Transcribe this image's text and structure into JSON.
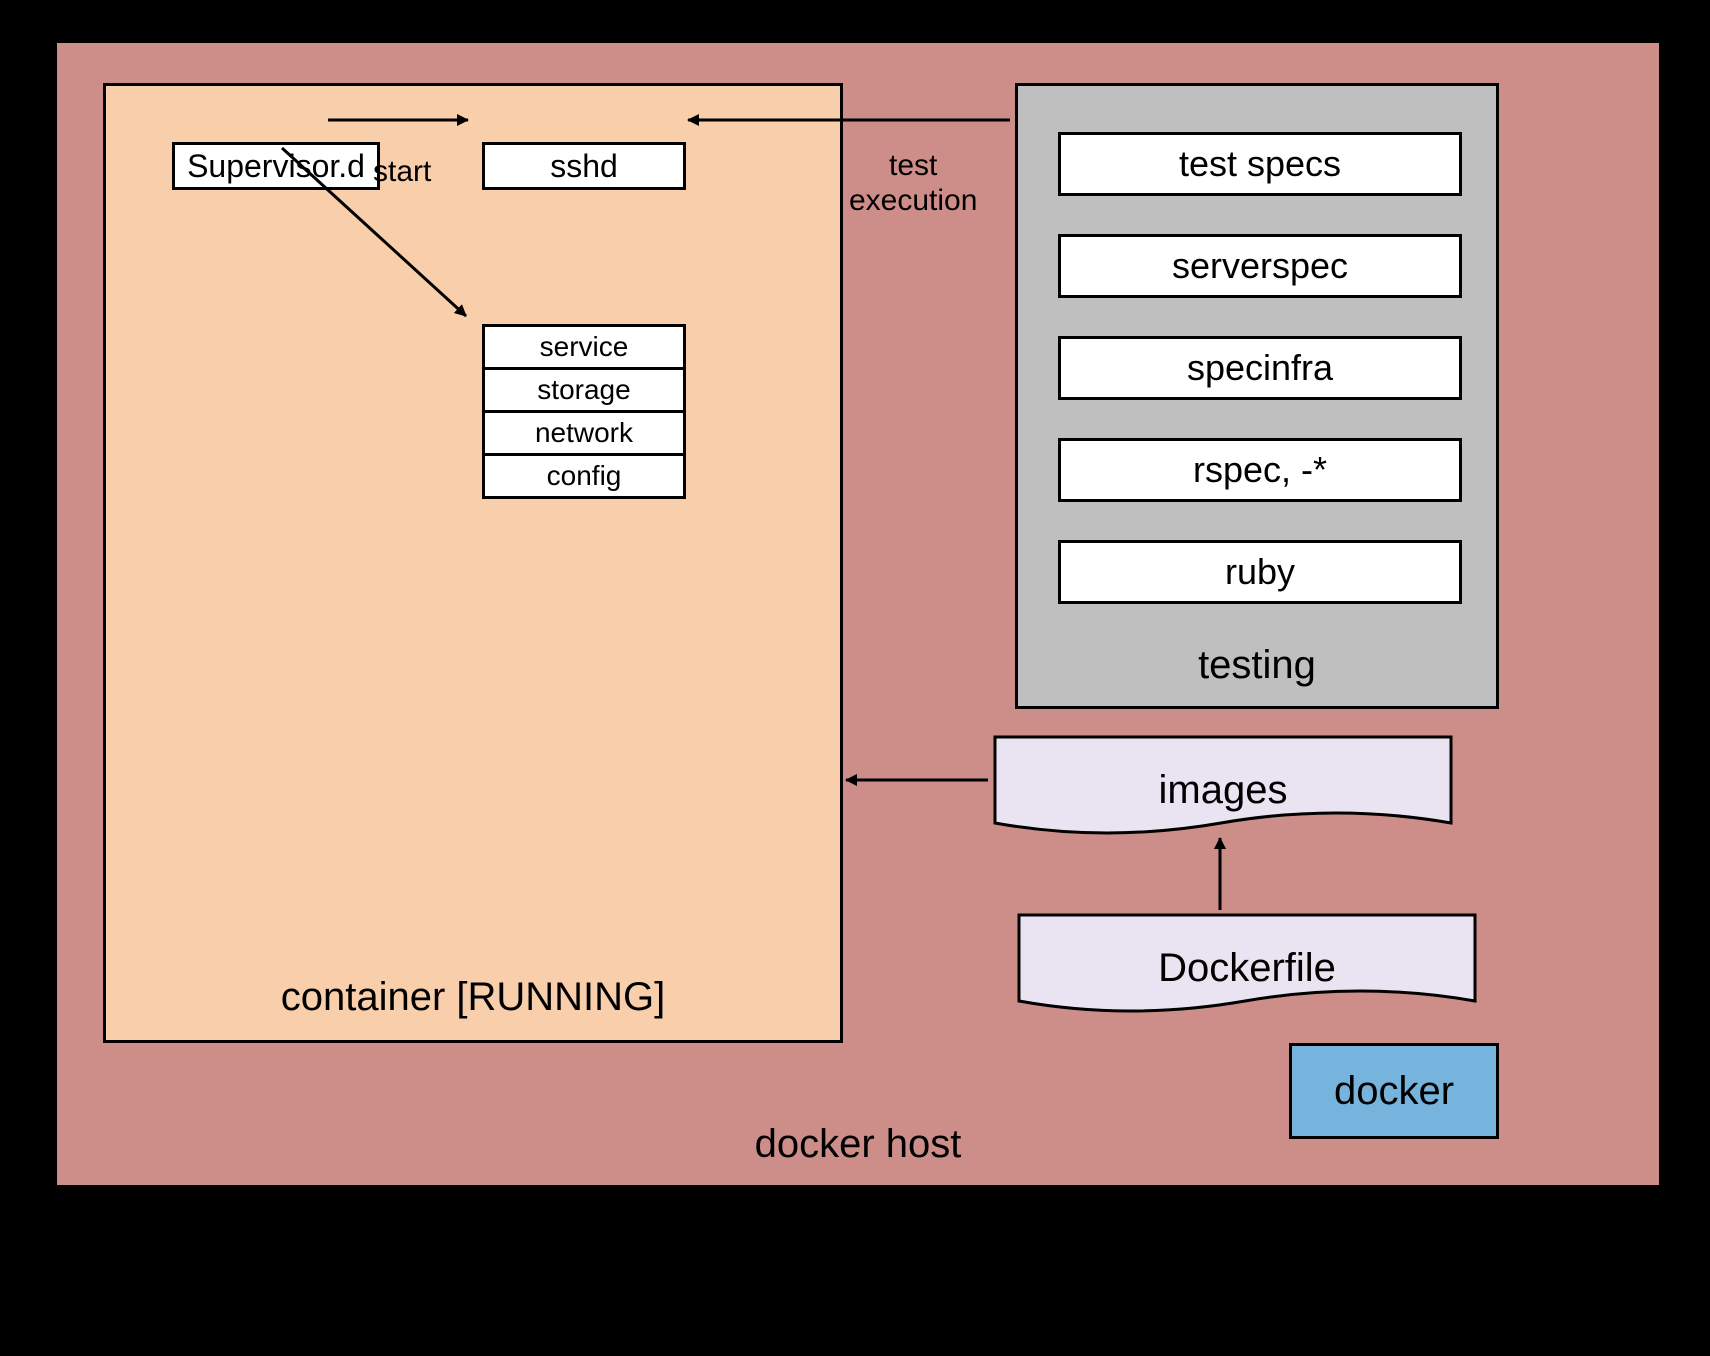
{
  "host": {
    "label": "docker host"
  },
  "container": {
    "label": "container [RUNNING]",
    "supervisor": "Supervisor.d",
    "sshd": "sshd",
    "stack": [
      "service",
      "storage",
      "network",
      "config"
    ]
  },
  "edges": {
    "start": "start",
    "test_execution": "test\nexecution"
  },
  "testing": {
    "label": "testing",
    "items": [
      "test specs",
      "serverspec",
      "specinfra",
      "rspec, -*",
      "ruby"
    ]
  },
  "docs": {
    "images": "images",
    "dockerfile": "Dockerfile"
  },
  "docker": {
    "label": "docker"
  }
}
